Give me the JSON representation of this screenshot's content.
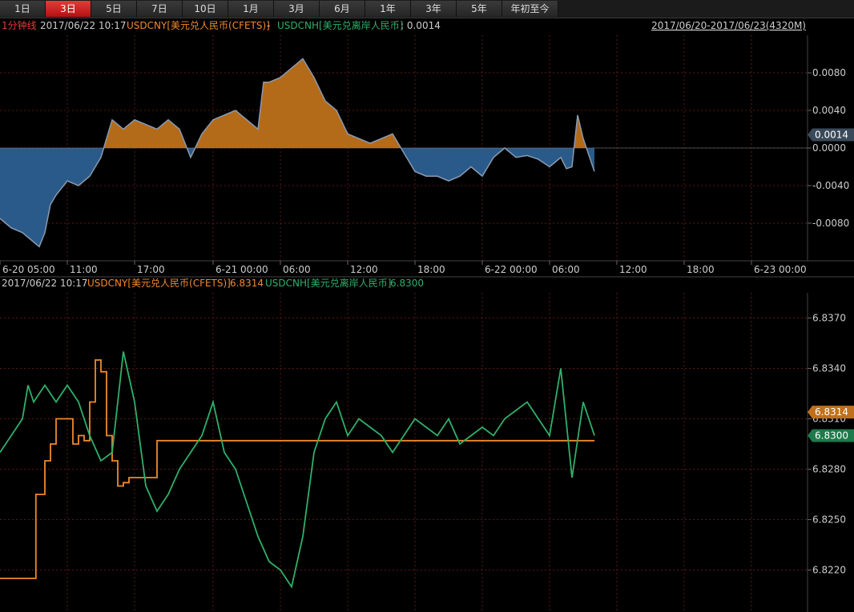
{
  "tabs": [
    "1日",
    "3日",
    "5日",
    "7日",
    "10日",
    "1月",
    "3月",
    "6月",
    "1年",
    "3年",
    "5年",
    "年初至今"
  ],
  "active_tab": 1,
  "colors": {
    "background": "#000000",
    "grid": "#5a1a1a",
    "cny": "#f08a2c",
    "cnh": "#2fb06a",
    "spread_pos": "#b36b1a",
    "spread_neg": "#2a5a8a",
    "spread_line": "#8a9ab0",
    "accent_red": "#e83a3a",
    "cnh_badge": "#1e7a4a",
    "cny_badge": "#c0701c",
    "spread_badge": "#3a4a5a"
  },
  "top_header": {
    "interval": "1分钟线",
    "datetime": "2017/06/22 10:17",
    "cny_label": "USDCNY[美元兑人民币(CFETS)]",
    "separator": "-",
    "cnh_label": "USDCNH[美元兑离岸人民币]",
    "value_text": ": 0.0014",
    "range": "2017/06/20-2017/06/23(4320M)"
  },
  "bottom_header": {
    "datetime": "2017/06/22 10:17",
    "cny_label": "USDCNY[美元兑人民币(CFETS)]",
    "cny_value": "6.8314",
    "cnh_label": "USDCNH[美元兑离岸人民币]",
    "cnh_value": "6.8300"
  },
  "chart_data": [
    {
      "type": "area",
      "name": "USDCNY - USDCNH spread",
      "ylim": [
        -0.012,
        0.012
      ],
      "yticks": [
        "0.0080",
        "0.0040",
        "0.0000",
        "-0.0040",
        "-0.0080"
      ],
      "ytick_values": [
        0.008,
        0.004,
        0.0,
        -0.004,
        -0.008
      ],
      "last_value": "0.0014",
      "x_ticks": [
        "6-20 05:00",
        "11:00",
        "17:00",
        "6-21 00:00",
        "06:00",
        "12:00",
        "18:00",
        "6-22 00:00",
        "06:00",
        "12:00",
        "18:00",
        "6-23 00:00"
      ],
      "x_tick_hours": [
        0,
        6,
        12,
        19,
        25,
        31,
        37,
        43,
        49,
        55,
        61,
        67
      ],
      "x_range_hours": [
        0,
        72
      ],
      "grid": true,
      "x": [
        0,
        1,
        2,
        3,
        3.5,
        4,
        4.5,
        5,
        6,
        7,
        8,
        9,
        10,
        11,
        12,
        13,
        14,
        15,
        16,
        17,
        18,
        19,
        20,
        21,
        22,
        23,
        23.5,
        24,
        25,
        26,
        27,
        28,
        29,
        30,
        31,
        32,
        33,
        34,
        35,
        36,
        37,
        38,
        39,
        40,
        41,
        42,
        43,
        44,
        45,
        46,
        47,
        48,
        49,
        49.5,
        50,
        50.5,
        51,
        51.5,
        52,
        53
      ],
      "values": [
        -0.0075,
        -0.0085,
        -0.009,
        -0.01,
        -0.0105,
        -0.009,
        -0.006,
        -0.005,
        -0.0035,
        -0.004,
        -0.003,
        -0.001,
        0.003,
        0.002,
        0.003,
        0.0025,
        0.002,
        0.003,
        0.002,
        -0.001,
        0.0015,
        0.003,
        0.0035,
        0.004,
        0.003,
        0.002,
        0.007,
        0.007,
        0.0075,
        0.0085,
        0.0095,
        0.0075,
        0.005,
        0.004,
        0.0015,
        0.001,
        0.0005,
        0.001,
        0.0015,
        -0.0005,
        -0.0025,
        -0.003,
        -0.003,
        -0.0035,
        -0.003,
        -0.002,
        -0.003,
        -0.001,
        0.0,
        -0.001,
        -0.0008,
        -0.0012,
        -0.002,
        -0.0015,
        -0.001,
        -0.0022,
        -0.002,
        0.0035,
        0.001,
        -0.0025,
        0.0014
      ]
    },
    {
      "type": "line",
      "ylim": [
        6.8195,
        6.8385
      ],
      "yticks": [
        "6.8370",
        "6.8340",
        "6.8310",
        "6.8280",
        "6.8250",
        "6.8220"
      ],
      "ytick_values": [
        6.837,
        6.834,
        6.831,
        6.828,
        6.825,
        6.822
      ],
      "x_range_hours": [
        0,
        72
      ],
      "grid": true,
      "series": [
        {
          "name": "USDCNY[美元兑人民币(CFETS)]",
          "x": [
            0,
            3,
            3.2,
            4,
            4.5,
            5,
            5.5,
            6,
            6.5,
            7,
            7.5,
            8,
            8.5,
            9,
            9.5,
            10,
            10.5,
            11,
            11.5,
            12,
            13,
            14,
            15,
            16,
            17,
            18,
            19,
            20,
            21,
            22,
            23,
            24,
            25,
            26,
            27,
            28,
            29,
            30,
            30.5,
            31,
            31.5,
            32,
            33,
            33.5,
            34,
            34.5,
            35,
            36,
            37,
            37.5,
            38,
            39,
            40,
            40.5,
            41,
            42,
            43,
            44,
            45,
            46,
            47,
            48,
            49,
            50,
            51,
            52,
            53
          ],
          "values": [
            6.8215,
            6.8215,
            6.8265,
            6.8285,
            6.8295,
            6.831,
            6.831,
            6.831,
            6.8295,
            6.83,
            6.8297,
            6.832,
            6.8345,
            6.8338,
            6.83,
            6.8285,
            6.827,
            6.8272,
            6.8275,
            6.8275,
            6.8275,
            6.8297,
            6.8297,
            6.8297,
            6.8297,
            6.8297,
            6.8297,
            6.8297,
            6.8297,
            6.8297,
            6.8297,
            6.8297,
            6.8297,
            6.8297,
            6.8297,
            6.8297,
            6.8297,
            6.8297,
            6.8297,
            6.8297,
            6.8297,
            6.8297,
            6.8297,
            6.8297,
            6.8297,
            6.8297,
            6.8297,
            6.8297,
            6.8297,
            6.8297,
            6.8297,
            6.8297,
            6.8297,
            6.8297,
            6.8297,
            6.8297,
            6.8297,
            6.8297,
            6.8297,
            6.8297,
            6.8297,
            6.8297,
            6.8297,
            6.8297,
            6.8297,
            6.8297,
            6.8297
          ]
        },
        {
          "name": "USDCNH[美元兑离岸人民币]",
          "x": [
            0,
            1,
            2,
            2.5,
            3,
            4,
            5,
            6,
            7,
            8,
            9,
            10,
            11,
            12,
            13,
            14,
            15,
            16,
            17,
            18,
            19,
            20,
            21,
            22,
            23,
            24,
            25,
            26,
            27,
            28,
            29,
            30,
            31,
            32,
            33,
            34,
            35,
            36,
            37,
            38,
            39,
            40,
            41,
            42,
            43,
            44,
            45,
            46,
            47,
            48,
            49,
            50,
            51,
            52,
            53
          ],
          "values": [
            6.829,
            6.83,
            6.831,
            6.833,
            6.832,
            6.833,
            6.832,
            6.833,
            6.832,
            6.83,
            6.8285,
            6.829,
            6.835,
            6.832,
            6.827,
            6.8255,
            6.8265,
            6.828,
            6.829,
            6.83,
            6.832,
            6.829,
            6.828,
            6.826,
            6.824,
            6.8225,
            6.822,
            6.821,
            6.824,
            6.829,
            6.831,
            6.832,
            6.83,
            6.831,
            6.8305,
            6.83,
            6.829,
            6.83,
            6.831,
            6.8305,
            6.83,
            6.831,
            6.8295,
            6.83,
            6.8305,
            6.83,
            6.831,
            6.8315,
            6.832,
            6.831,
            6.83,
            6.834,
            6.8275,
            6.832,
            6.83
          ]
        }
      ]
    }
  ]
}
